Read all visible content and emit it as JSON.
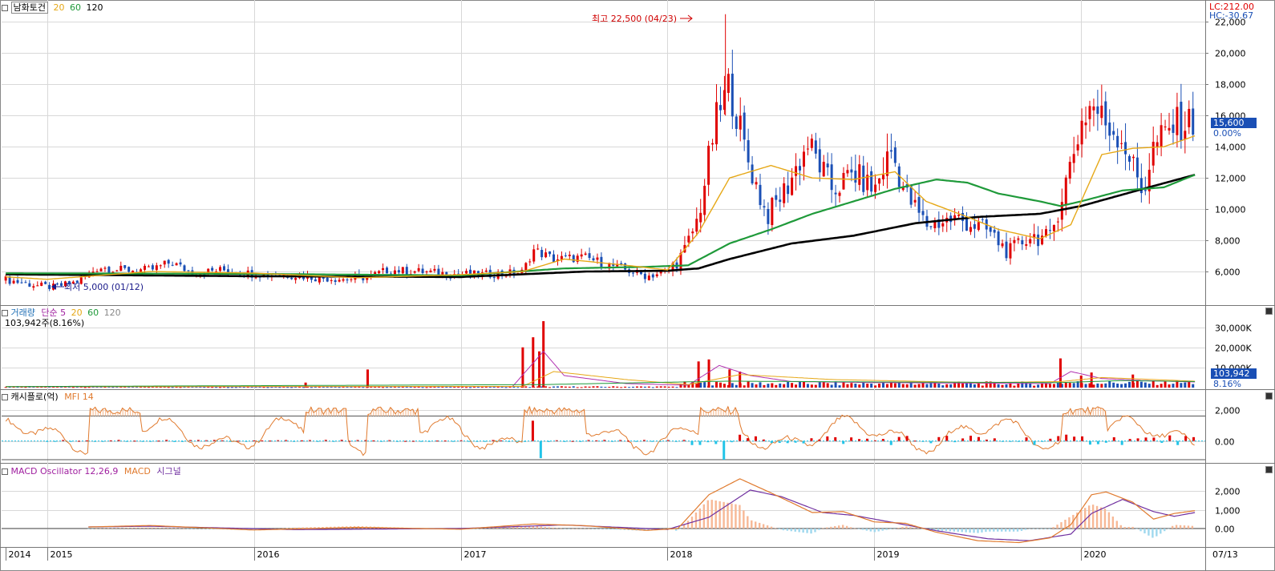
{
  "stock": {
    "name": "남화토건",
    "ma_periods": [
      "20",
      "60",
      "120"
    ],
    "high_note": "최고 22,500 (04/23)",
    "low_note": "최저 5,000 (01/12)",
    "last_price": "15,600",
    "last_change": "0.00%",
    "lc": "LC:212.00",
    "hc": "HC:-30.67"
  },
  "volume_panel": {
    "title": "거래량",
    "ma_label": "단순 5",
    "ma_periods": [
      "20",
      "60",
      "120"
    ],
    "info": "103,942주(8.16%)",
    "last_value": "103,942",
    "last_pct": "8.16%"
  },
  "mfi_panel": {
    "title": "캐시플로(억)",
    "indicator": "MFI 14"
  },
  "macd_panel": {
    "title": "MACD Oscillator 12,26,9",
    "macd": "MACD",
    "signal": "시그널"
  },
  "colors": {
    "up": "#e00000",
    "down": "#1a4fb5",
    "ma20": "#e6a817",
    "ma60": "#1f9a3a",
    "ma120": "#000000",
    "mfi": "#e07a2e",
    "mfi_fill": "#f7c09a",
    "cyan": "#22c4e8",
    "macd": "#e07a2e",
    "signal": "#7030a0",
    "macd_pos": "#f7b896",
    "macd_neg": "#9fd8ee"
  },
  "chart_data": [
    {
      "type": "candlestick",
      "panel": "price",
      "x_axis": [
        "2014",
        "2015",
        "2016",
        "2017",
        "2018",
        "2019",
        "2020",
        "07/13"
      ],
      "y_ticks": [
        "6,000",
        "8,000",
        "10,000",
        "12,000",
        "14,000",
        "16,000",
        "18,000",
        "20,000",
        "22,000"
      ],
      "ylim": [
        4000,
        23000
      ],
      "close_path": [
        [
          2014.5,
          5950
        ],
        [
          2014.75,
          5600
        ],
        [
          2014.95,
          5100
        ],
        [
          2015.03,
          5000
        ],
        [
          2015.15,
          5350
        ],
        [
          2015.25,
          6300
        ],
        [
          2015.35,
          6100
        ],
        [
          2015.5,
          6100
        ],
        [
          2015.6,
          6600
        ],
        [
          2015.7,
          5900
        ],
        [
          2015.85,
          6100
        ],
        [
          2016.0,
          5850
        ],
        [
          2016.2,
          5750
        ],
        [
          2016.3,
          5600
        ],
        [
          2016.45,
          5500
        ],
        [
          2016.55,
          5650
        ],
        [
          2016.65,
          6100
        ],
        [
          2016.8,
          6000
        ],
        [
          2016.95,
          5850
        ],
        [
          2017.1,
          5800
        ],
        [
          2017.3,
          5950
        ],
        [
          2017.35,
          7400
        ],
        [
          2017.45,
          6800
        ],
        [
          2017.6,
          6900
        ],
        [
          2017.75,
          6300
        ],
        [
          2017.9,
          5700
        ],
        [
          2018.0,
          6000
        ],
        [
          2018.08,
          7200
        ],
        [
          2018.15,
          9500
        ],
        [
          2018.23,
          15500
        ],
        [
          2018.3,
          18000
        ],
        [
          2018.38,
          13500
        ],
        [
          2018.48,
          9500
        ],
        [
          2018.58,
          11500
        ],
        [
          2018.68,
          14200
        ],
        [
          2018.8,
          11200
        ],
        [
          2018.9,
          12300
        ],
        [
          2019.0,
          11200
        ],
        [
          2019.08,
          13800
        ],
        [
          2019.15,
          11000
        ],
        [
          2019.25,
          9000
        ],
        [
          2019.4,
          9400
        ],
        [
          2019.55,
          8600
        ],
        [
          2019.65,
          7200
        ],
        [
          2019.75,
          8300
        ],
        [
          2019.85,
          8100
        ],
        [
          2019.9,
          10500
        ],
        [
          2020.0,
          15500
        ],
        [
          2020.05,
          16800
        ],
        [
          2020.12,
          15500
        ],
        [
          2020.2,
          14500
        ],
        [
          2020.3,
          11000
        ],
        [
          2020.35,
          14000
        ],
        [
          2020.45,
          15400
        ],
        [
          2020.55,
          15600
        ]
      ],
      "ma20_path": [
        [
          2014.5,
          5900
        ],
        [
          2015.0,
          5500
        ],
        [
          2015.5,
          6000
        ],
        [
          2016.0,
          5900
        ],
        [
          2016.5,
          5600
        ],
        [
          2017.0,
          5800
        ],
        [
          2017.3,
          6000
        ],
        [
          2017.5,
          6800
        ],
        [
          2017.8,
          6400
        ],
        [
          2018.0,
          6100
        ],
        [
          2018.15,
          8500
        ],
        [
          2018.3,
          12000
        ],
        [
          2018.5,
          12800
        ],
        [
          2018.7,
          12000
        ],
        [
          2018.9,
          11900
        ],
        [
          2019.1,
          12400
        ],
        [
          2019.25,
          10500
        ],
        [
          2019.45,
          9500
        ],
        [
          2019.6,
          8700
        ],
        [
          2019.8,
          8100
        ],
        [
          2019.95,
          9000
        ],
        [
          2020.1,
          13500
        ],
        [
          2020.25,
          13900
        ],
        [
          2020.4,
          14000
        ],
        [
          2020.55,
          14700
        ]
      ],
      "ma60_path": [
        [
          2014.5,
          5900
        ],
        [
          2016.0,
          5850
        ],
        [
          2017.0,
          5750
        ],
        [
          2017.5,
          6200
        ],
        [
          2017.9,
          6300
        ],
        [
          2018.1,
          6400
        ],
        [
          2018.3,
          7800
        ],
        [
          2018.5,
          8700
        ],
        [
          2018.7,
          9700
        ],
        [
          2018.9,
          10500
        ],
        [
          2019.1,
          11300
        ],
        [
          2019.3,
          11900
        ],
        [
          2019.45,
          11700
        ],
        [
          2019.6,
          11000
        ],
        [
          2019.8,
          10500
        ],
        [
          2019.9,
          10200
        ],
        [
          2020.0,
          10500
        ],
        [
          2020.2,
          11200
        ],
        [
          2020.4,
          11400
        ],
        [
          2020.55,
          12200
        ]
      ],
      "ma120_path": [
        [
          2014.5,
          5850
        ],
        [
          2016.0,
          5700
        ],
        [
          2017.0,
          5650
        ],
        [
          2017.6,
          6000
        ],
        [
          2018.0,
          6050
        ],
        [
          2018.15,
          6200
        ],
        [
          2018.3,
          6800
        ],
        [
          2018.6,
          7800
        ],
        [
          2018.9,
          8300
        ],
        [
          2019.2,
          9100
        ],
        [
          2019.5,
          9500
        ],
        [
          2019.8,
          9700
        ],
        [
          2020.0,
          10200
        ],
        [
          2020.3,
          11300
        ],
        [
          2020.55,
          12200
        ]
      ]
    },
    {
      "type": "bar",
      "panel": "volume",
      "y_ticks": [
        "10,000K",
        "20,000K",
        "30,000K"
      ],
      "ylim": [
        0,
        35000
      ],
      "spikes_k": [
        [
          2016.25,
          2500
        ],
        [
          2016.55,
          9000
        ],
        [
          2017.3,
          20000
        ],
        [
          2017.35,
          25000
        ],
        [
          2017.38,
          18000
        ],
        [
          2017.4,
          33000
        ],
        [
          2018.15,
          13000
        ],
        [
          2018.2,
          14000
        ],
        [
          2018.3,
          9000
        ],
        [
          2018.35,
          8000
        ],
        [
          2019.9,
          14500
        ],
        [
          2020.0,
          6000
        ],
        [
          2020.05,
          7500
        ],
        [
          2020.25,
          6500
        ]
      ]
    },
    {
      "type": "line",
      "panel": "mfi",
      "y_ticks": [
        "0.00",
        "2,000"
      ],
      "ylim": [
        -1300,
        2600
      ]
    },
    {
      "type": "line",
      "panel": "macd",
      "y_ticks": [
        "0.00",
        "1,000",
        "2,000"
      ],
      "ylim": [
        -900,
        2900
      ],
      "macd_path": [
        [
          2014.5,
          0
        ],
        [
          2015.2,
          80
        ],
        [
          2015.5,
          160
        ],
        [
          2016.0,
          -80
        ],
        [
          2016.5,
          60
        ],
        [
          2017.0,
          -40
        ],
        [
          2017.35,
          240
        ],
        [
          2017.6,
          150
        ],
        [
          2017.9,
          -100
        ],
        [
          2018.05,
          0
        ],
        [
          2018.2,
          1800
        ],
        [
          2018.35,
          2650
        ],
        [
          2018.5,
          1900
        ],
        [
          2018.7,
          850
        ],
        [
          2018.85,
          900
        ],
        [
          2019.0,
          350
        ],
        [
          2019.15,
          280
        ],
        [
          2019.3,
          -200
        ],
        [
          2019.5,
          -650
        ],
        [
          2019.7,
          -750
        ],
        [
          2019.85,
          -500
        ],
        [
          2019.95,
          200
        ],
        [
          2020.05,
          1800
        ],
        [
          2020.12,
          1950
        ],
        [
          2020.25,
          1400
        ],
        [
          2020.35,
          500
        ],
        [
          2020.45,
          800
        ],
        [
          2020.55,
          950
        ]
      ],
      "signal_path": [
        [
          2014.5,
          0
        ],
        [
          2015.5,
          120
        ],
        [
          2016.2,
          -60
        ],
        [
          2017.0,
          0
        ],
        [
          2017.5,
          190
        ],
        [
          2018.0,
          -50
        ],
        [
          2018.2,
          600
        ],
        [
          2018.4,
          2050
        ],
        [
          2018.55,
          1700
        ],
        [
          2018.75,
          850
        ],
        [
          2018.9,
          700
        ],
        [
          2019.1,
          300
        ],
        [
          2019.3,
          -120
        ],
        [
          2019.55,
          -550
        ],
        [
          2019.75,
          -650
        ],
        [
          2019.95,
          -300
        ],
        [
          2020.05,
          800
        ],
        [
          2020.2,
          1550
        ],
        [
          2020.35,
          900
        ],
        [
          2020.45,
          650
        ],
        [
          2020.55,
          850
        ]
      ]
    }
  ]
}
